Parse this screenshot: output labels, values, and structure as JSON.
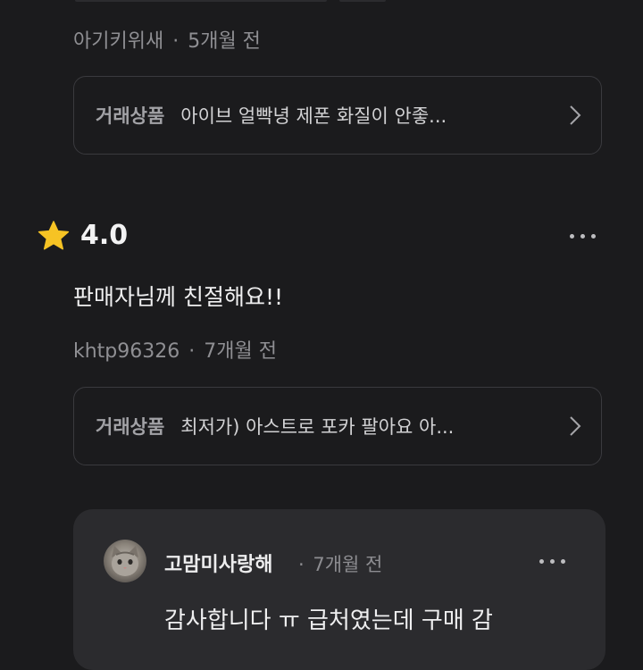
{
  "top_review": {
    "author": "아기키위새",
    "time": "5개월 전",
    "product_label": "거래상품",
    "product_name": "아이브 얼빡녕 제폰 화질이 안좋..."
  },
  "review": {
    "rating": "4.0",
    "text": "판매자님께 친절해요!!",
    "author": "khtp96326",
    "time": "7개월 전",
    "product_label": "거래상품",
    "product_name": "최저가) 아스트로 포카 팔아요 아..."
  },
  "reply": {
    "author": "고맘미사랑해",
    "time": "7개월 전",
    "text": "감사합니다 ㅠ 급처였는데 구매 감"
  },
  "separator": "·",
  "colors": {
    "background": "#1b1b1d",
    "card_border": "#3a3a3e",
    "reply_bg": "#2b2b2e",
    "star": "#f6c324",
    "meta_text": "#8f8f93"
  },
  "icons": [
    "star-icon",
    "chevron-right-icon",
    "more-options-icon"
  ]
}
